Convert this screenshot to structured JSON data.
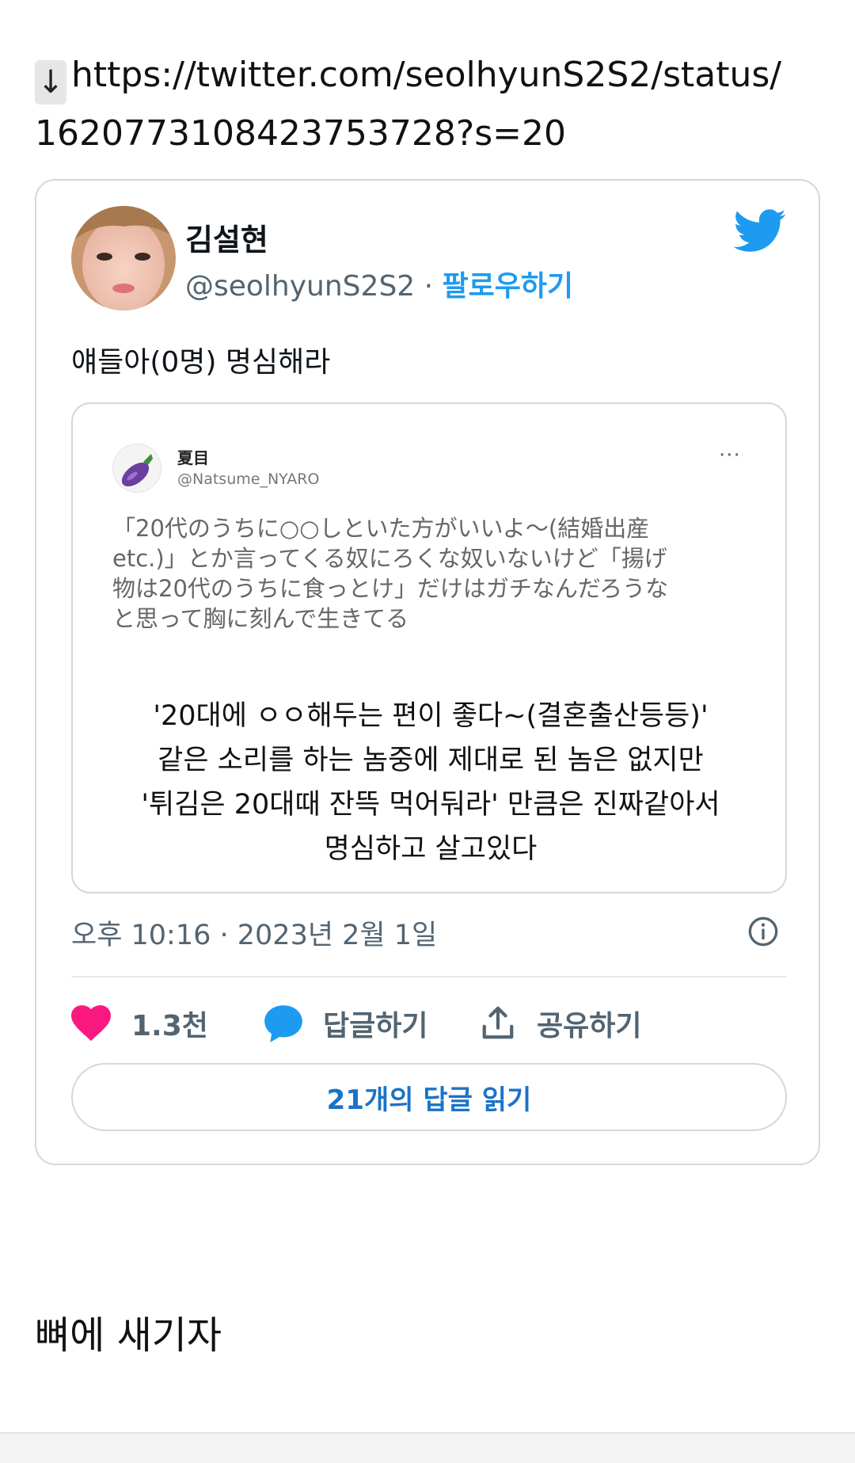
{
  "link": {
    "download_glyph": "↓",
    "url_line1": "https://twitter.com/seolhyunS2S2/status/",
    "url_line2": "1620773108423753728?s=20"
  },
  "tweet": {
    "display_name": "김설현",
    "handle": "@seolhyunS2S2",
    "separator": "·",
    "follow_label": "팔로우하기",
    "text": "얘들아(0명) 명심해라",
    "timestamp": "오후 10:16 · 2023년 2월 1일",
    "like_count": "1.3천",
    "reply_label": "답글하기",
    "share_label": "공유하기",
    "read_replies_label": "21개의 답글 읽기"
  },
  "quoted": {
    "name": "夏目",
    "handle": "@Natsume_NYARO",
    "more": "···",
    "jp_lines": [
      "「20代のうちに○○しといた方がいいよ〜(結婚出産",
      "etc.)」とか言ってくる奴にろくな奴いないけど「揚げ",
      "物は20代のうちに食っとけ」だけはガチなんだろうな",
      "と思って胸に刻んで生きてる"
    ],
    "ko_lines": [
      "'20대에 ㅇㅇ해두는 편이 좋다~(결혼출산등등)'",
      "같은 소리를 하는 놈중에 제대로 된 놈은 없지만",
      "'튀김은 20대때 잔뜩 먹어둬라' 만큼은 진짜같아서",
      "명심하고 살고있다"
    ]
  },
  "caption": "뼈에 새기자",
  "colors": {
    "twitter_blue": "#1d9bf0",
    "heart": "#f91880",
    "muted": "#536471",
    "border": "#cfd9de"
  },
  "icons": [
    "download-arrow-icon",
    "twitter-bird-icon",
    "eggplant-icon",
    "info-icon",
    "heart-icon",
    "reply-bubble-icon",
    "share-icon"
  ]
}
